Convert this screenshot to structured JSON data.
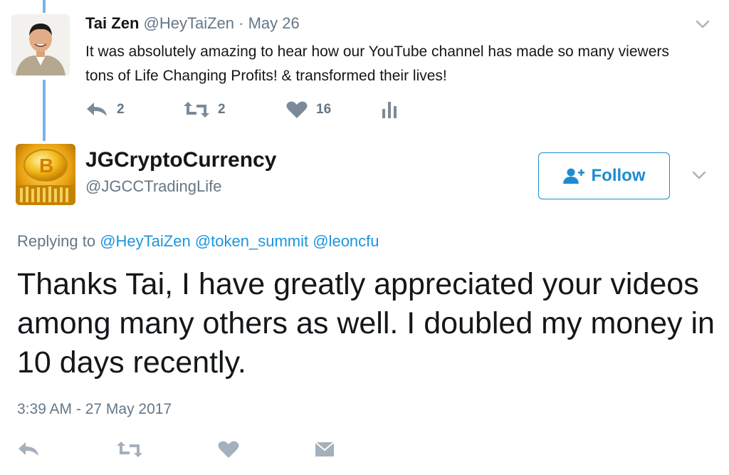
{
  "parent_tweet": {
    "name": "Tai Zen",
    "handle": "@HeyTaiZen",
    "separator": "·",
    "date": "May 26",
    "text": "It was absolutely amazing to hear how our YouTube channel has made so many viewers tons of Life Changing Profits! & transformed their lives!",
    "replies": "2",
    "retweets": "2",
    "likes": "16"
  },
  "reply_tweet": {
    "name": "JGCryptoCurrency",
    "handle": "@JGCCTradingLife",
    "follow_label": "Follow",
    "replying_prefix": "Replying to",
    "mentions": [
      "@HeyTaiZen",
      "@token_summit",
      "@leoncfu"
    ],
    "text": "Thanks Tai, I have greatly appreciated your videos among many others as well. I doubled my money in 10 days recently.",
    "timestamp": "3:39 AM - 27 May 2017"
  },
  "icons": [
    "chevron-down-icon",
    "reply-icon",
    "retweet-icon",
    "like-icon",
    "analytics-icon",
    "follow-user-icon",
    "message-icon"
  ],
  "colors": {
    "accent": "#1d8ccf",
    "mention": "#1b95e0",
    "muted": "#657786",
    "thread_line": "#7eb2e3",
    "text": "#14171a"
  }
}
